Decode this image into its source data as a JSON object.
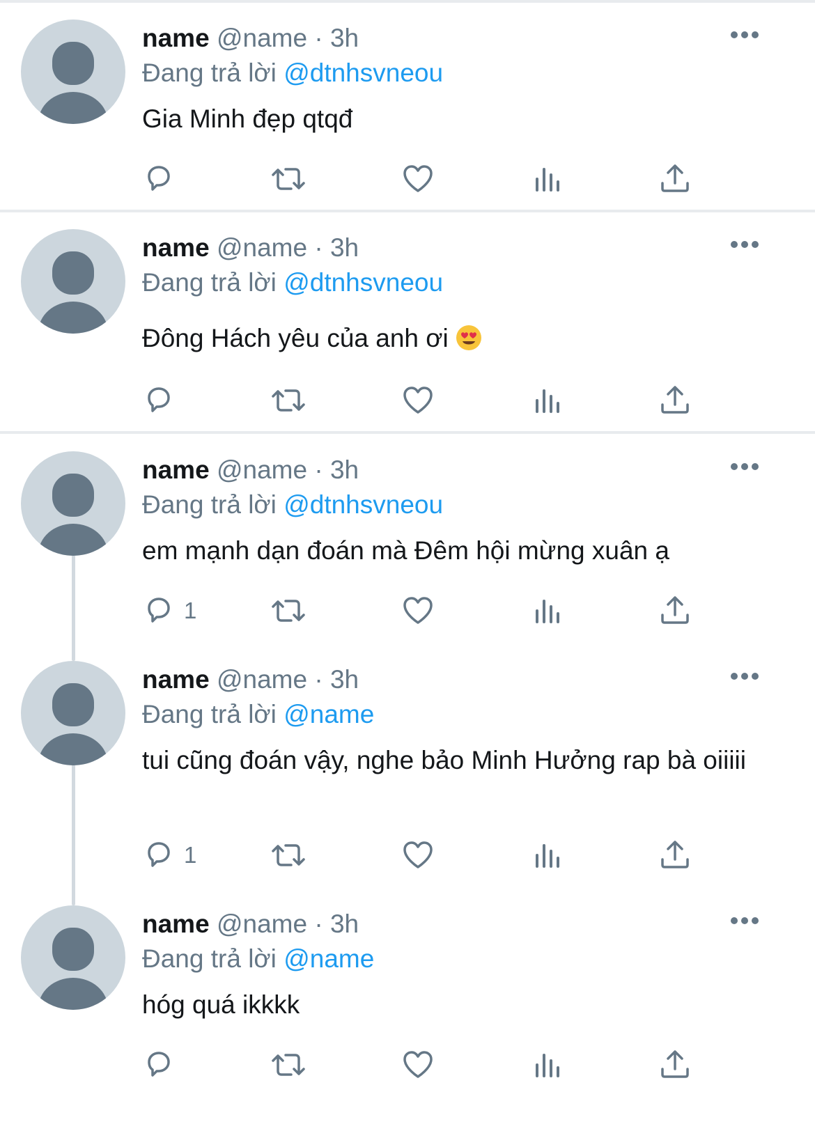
{
  "colors": {
    "accent": "#1d9bf0",
    "muted": "#657786",
    "text": "#14171a",
    "avatar_bg": "#ccd6dd",
    "avatar_fg": "#657786"
  },
  "icons": {
    "avatar": "default-profile-icon",
    "more": "more-horizontal-icon",
    "reply": "reply-bubble-icon",
    "retweet": "retweet-icon",
    "like": "heart-icon",
    "views": "views-bar-chart-icon",
    "share": "share-upload-icon",
    "emoji": "smiling-face-with-heart-eyes"
  },
  "tweets": [
    {
      "name": "name",
      "handle": "@name",
      "sep": "·",
      "time": "3h",
      "reply_prefix": "Đang trả lời",
      "reply_to": "@dtnhsvneou",
      "text": "Gia Minh đẹp qtqđ",
      "reply_count": ""
    },
    {
      "name": "name",
      "handle": "@name",
      "sep": "·",
      "time": "3h",
      "reply_prefix": "Đang trả lời",
      "reply_to": "@dtnhsvneou",
      "text": "Đông Hách yêu của anh ơi",
      "reply_count": ""
    },
    {
      "name": "name",
      "handle": "@name",
      "sep": "·",
      "time": "3h",
      "reply_prefix": "Đang trả lời",
      "reply_to": "@dtnhsvneou",
      "text": "em mạnh dạn đoán mà Đêm hội mừng xuân ạ",
      "reply_count": "1"
    },
    {
      "name": "name",
      "handle": "@name",
      "sep": "·",
      "time": "3h",
      "reply_prefix": "Đang trả lời",
      "reply_to": "@name",
      "text": "tui cũng đoán vậy, nghe bảo Minh Hưởng rap bà oiiiii",
      "reply_count": "1"
    },
    {
      "name": "name",
      "handle": "@name",
      "sep": "·",
      "time": "3h",
      "reply_prefix": "Đang trả lời",
      "reply_to": "@name",
      "text": "hóg quá ikkkk",
      "reply_count": ""
    }
  ]
}
